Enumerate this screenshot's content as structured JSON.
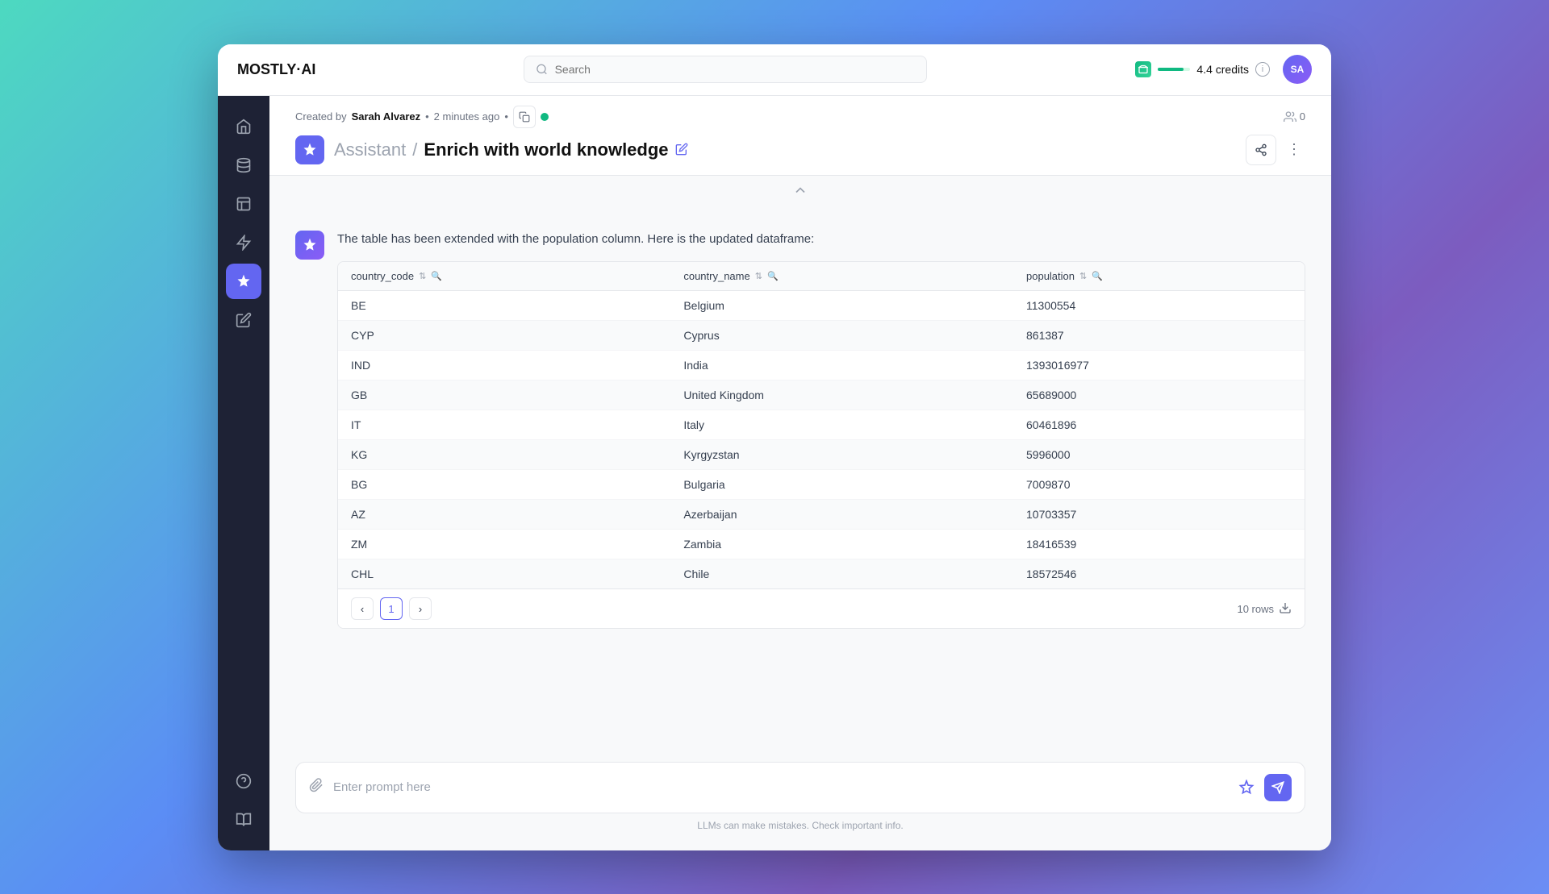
{
  "app": {
    "logo": "MOSTLY·AI",
    "window_title": "Enrich with world knowledge"
  },
  "topbar": {
    "search_placeholder": "Search",
    "credits_label": "4.4 credits",
    "avatar_initials": "SA",
    "info_icon": "ℹ"
  },
  "sidebar": {
    "items": [
      {
        "id": "home",
        "icon": "home",
        "active": false
      },
      {
        "id": "data",
        "icon": "database",
        "active": false
      },
      {
        "id": "tables",
        "icon": "table",
        "active": false
      },
      {
        "id": "lightning",
        "icon": "lightning",
        "active": false
      },
      {
        "id": "assistant",
        "icon": "sparkle",
        "active": true
      },
      {
        "id": "edit",
        "icon": "edit",
        "active": false
      }
    ],
    "bottom_items": [
      {
        "id": "help",
        "icon": "help"
      },
      {
        "id": "docs",
        "icon": "book"
      }
    ]
  },
  "subheader": {
    "created_by_label": "Created by",
    "author": "Sarah Alvarez",
    "time_ago": "2 minutes ago",
    "user_count": "0",
    "breadcrumb_parent": "Assistant",
    "breadcrumb_separator": "/",
    "title": "Enrich with world knowledge"
  },
  "chat": {
    "message": "The table has been extended with the population column. Here is the updated dataframe:",
    "table": {
      "columns": [
        {
          "id": "country_code",
          "label": "country_code"
        },
        {
          "id": "country_name",
          "label": "country_name"
        },
        {
          "id": "population",
          "label": "population"
        }
      ],
      "rows": [
        {
          "country_code": "BE",
          "country_name": "Belgium",
          "population": "11300554"
        },
        {
          "country_code": "CYP",
          "country_name": "Cyprus",
          "population": "861387"
        },
        {
          "country_code": "IND",
          "country_name": "India",
          "population": "1393016977"
        },
        {
          "country_code": "GB",
          "country_name": "United Kingdom",
          "population": "65689000"
        },
        {
          "country_code": "IT",
          "country_name": "Italy",
          "population": "60461896"
        },
        {
          "country_code": "KG",
          "country_name": "Kyrgyzstan",
          "population": "5996000"
        },
        {
          "country_code": "BG",
          "country_name": "Bulgaria",
          "population": "7009870"
        },
        {
          "country_code": "AZ",
          "country_name": "Azerbaijan",
          "population": "10703357"
        },
        {
          "country_code": "ZM",
          "country_name": "Zambia",
          "population": "18416539"
        },
        {
          "country_code": "CHL",
          "country_name": "Chile",
          "population": "18572546"
        }
      ],
      "pagination": {
        "current_page": "1",
        "rows_count": "10 rows"
      }
    }
  },
  "input": {
    "placeholder": "Enter prompt here",
    "disclaimer": "LLMs can make mistakes. Check important info."
  }
}
